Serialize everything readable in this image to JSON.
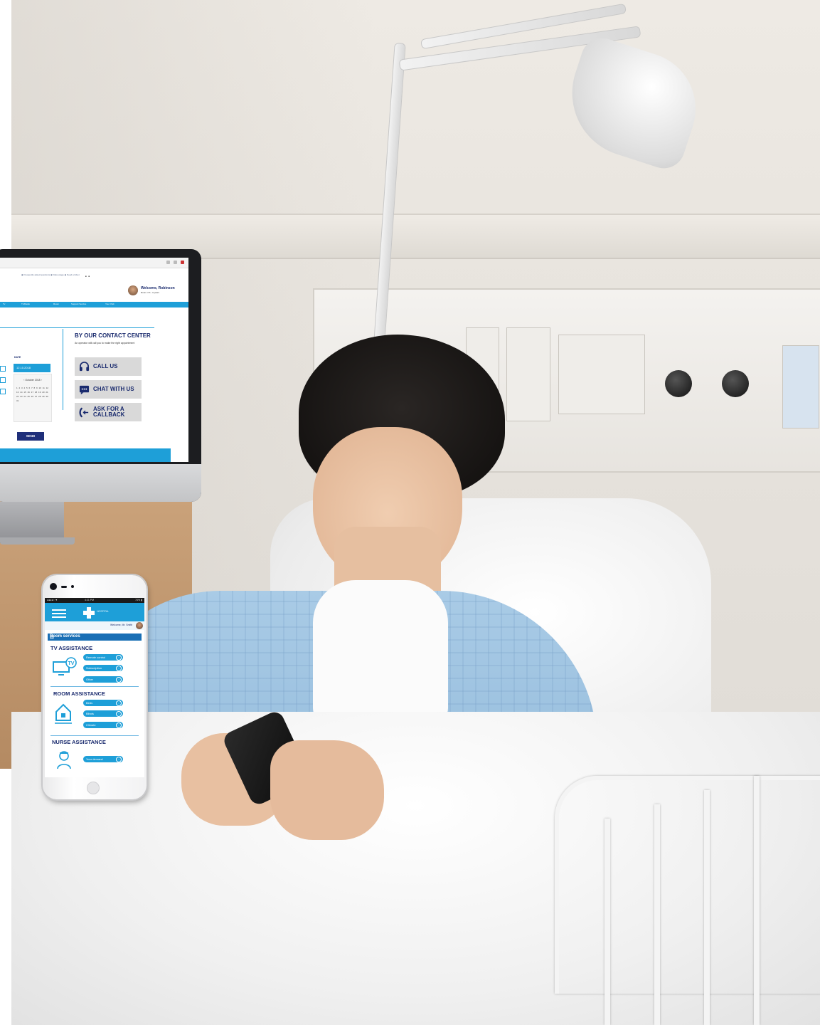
{
  "desktop": {
    "top_links": "◉ Frequently asked questions   ◉ Data usage   ◉ Need a ticket",
    "welcome_title": "Welcome, Robinson",
    "welcome_sub": "Room n°b - 3 years",
    "nav_items": [
      "Tv",
      "Tv/Radio",
      "Room",
      "Support Service",
      "Your Visit"
    ],
    "contact_center": {
      "title": "BY OUR CONTACT CENTER",
      "text": "An operator will call you to make the right appointment",
      "buttons": [
        {
          "label": "CALL US",
          "icon": "headset-icon"
        },
        {
          "label": "CHAT WITH US",
          "icon": "chat-bubble-icon"
        },
        {
          "label": "ASK FOR A CALLBACK",
          "icon": "callback-phone-icon"
        }
      ]
    },
    "form": {
      "date_label": "DATE",
      "date_value": "12.10.2018",
      "calendar_header": "‹  October 2018  ›",
      "calendar_days": "1 2 3 4 5 6 7 8 9 10 11 12 13 14 15 16 17 18 19 20 21 22 23 24 25 26 27 28 29 30 31",
      "send_label": "SEND"
    }
  },
  "mobile": {
    "status_left": "●●●●○ ▼",
    "status_time": "4:21 PM",
    "status_right": "74% ▮",
    "logo_text": "HOSPITAL",
    "welcome": "Welcome, Mr. Smith",
    "room_services_label": "Room services",
    "sections": [
      {
        "title": "TV ASSISTANCE",
        "icon": "tv-icon",
        "items": [
          "Remote control",
          "Subscription",
          "Other"
        ]
      },
      {
        "title": "ROOM ASSISTANCE",
        "icon": "house-icon",
        "items": [
          "Beds",
          "Blinds",
          "Climate"
        ]
      },
      {
        "title": "NURSE ASSISTANCE",
        "icon": "nurse-icon",
        "items": [
          "Your demand"
        ]
      }
    ]
  },
  "colors": {
    "accent": "#1e9fd8",
    "navy": "#1a2b6e",
    "room_services_bar": "#1a6fb5"
  }
}
